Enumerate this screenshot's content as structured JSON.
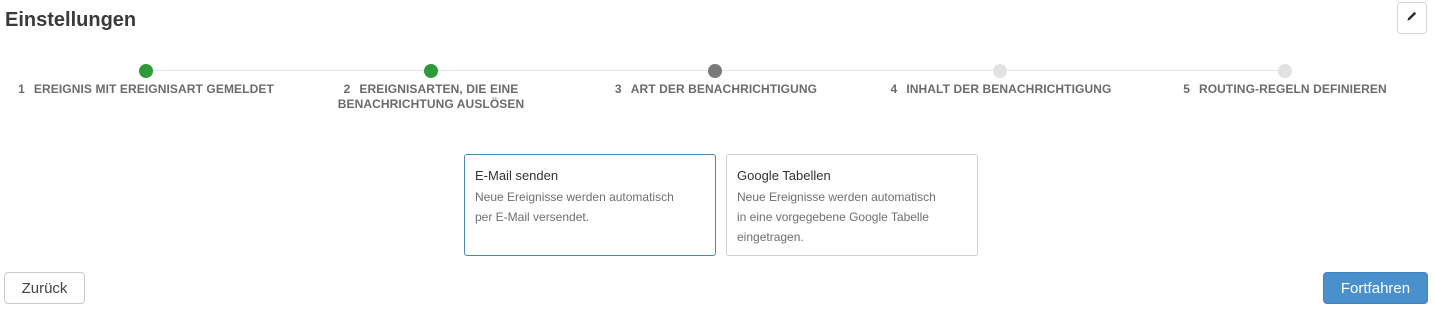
{
  "header": {
    "title": "Einstellungen",
    "edit_icon": "pencil-icon"
  },
  "colors": {
    "step_done": "#2f9a3a",
    "step_current": "#7a7a7a",
    "step_pending": "#e2e2e2",
    "primary": "#4a90cd",
    "selected_border": "#4a88b4"
  },
  "stepper": {
    "steps": [
      {
        "number": "1",
        "label": "EREIGNIS MIT EREIGNISART GEMELDET",
        "status": "done"
      },
      {
        "number": "2",
        "label_line1": "EREIGNISARTEN, DIE EINE",
        "label_line2": "BENACHRICHTUNG AUSLÖSEN",
        "status": "done"
      },
      {
        "number": "3",
        "label": "ART DER BENACHRICHTIGUNG",
        "status": "current"
      },
      {
        "number": "4",
        "label": "INHALT DER BENACHRICHTIGUNG",
        "status": "pending"
      },
      {
        "number": "5",
        "label": "ROUTING-REGELN DEFINIEREN",
        "status": "pending"
      }
    ]
  },
  "options": [
    {
      "title": "E-Mail senden",
      "description_lines": [
        "Neue Ereignisse werden automatisch",
        "per E-Mail versendet."
      ],
      "selected": true
    },
    {
      "title": "Google Tabellen",
      "description_lines": [
        "Neue Ereignisse werden automatisch",
        "in eine vorgegebene Google Tabelle",
        "eingetragen."
      ],
      "selected": false
    }
  ],
  "footer": {
    "back_label": "Zurück",
    "next_label": "Fortfahren"
  }
}
